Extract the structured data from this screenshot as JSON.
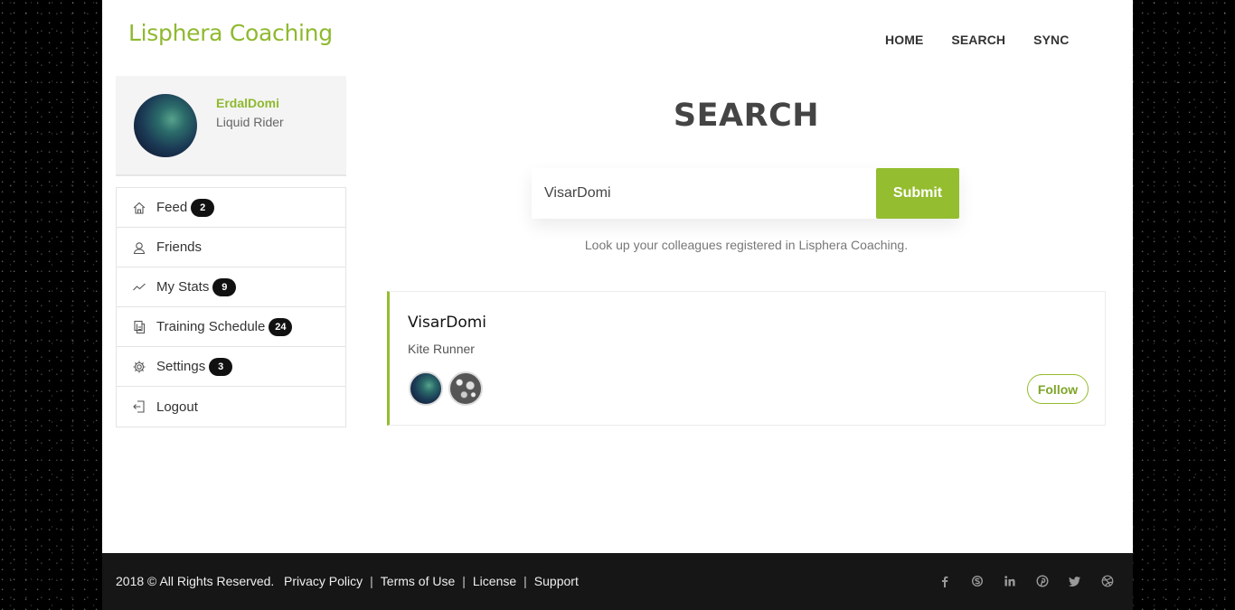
{
  "brand": "Lisphera Coaching",
  "nav": [
    {
      "label": "HOME"
    },
    {
      "label": "SEARCH"
    },
    {
      "label": "SYNC"
    }
  ],
  "profile": {
    "username": "ErdalDomi",
    "title": "Liquid Rider"
  },
  "menu": [
    {
      "label": "Feed",
      "icon": "home-icon",
      "badge": "2"
    },
    {
      "label": "Friends",
      "icon": "user-icon",
      "badge": ""
    },
    {
      "label": "My Stats",
      "icon": "chart-line-icon",
      "badge": "9"
    },
    {
      "label": "Training Schedule",
      "icon": "document-icon",
      "badge": "24"
    },
    {
      "label": "Settings",
      "icon": "gear-icon",
      "badge": "3"
    },
    {
      "label": "Logout",
      "icon": "logout-icon",
      "badge": ""
    }
  ],
  "search": {
    "heading": "SEARCH",
    "value": "VisarDomi",
    "submit_label": "Submit",
    "help_text": "Look up your colleagues registered in Lisphera Coaching."
  },
  "result": {
    "name": "VisarDomi",
    "title": "Kite Runner",
    "follow_label": "Follow"
  },
  "footer": {
    "copyright": "2018 © All Rights Reserved.",
    "links": [
      "Privacy Policy",
      "Terms of Use",
      "License",
      "Support"
    ],
    "social": [
      "facebook-icon",
      "skype-icon",
      "linkedin-icon",
      "pinterest-icon",
      "twitter-icon",
      "dribbble-icon"
    ]
  },
  "colors": {
    "accent": "#94bd2f",
    "footer_bg": "#161616"
  }
}
